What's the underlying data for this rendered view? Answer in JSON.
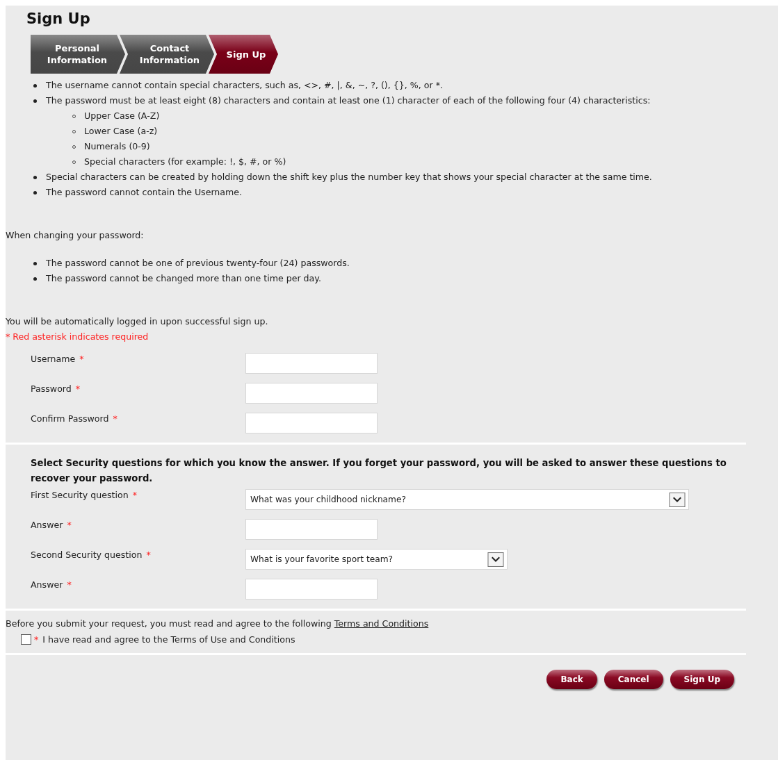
{
  "title": "Sign Up",
  "steps": [
    {
      "label": "Personal Information",
      "selected": false
    },
    {
      "label": "Contact Information",
      "selected": false
    },
    {
      "label": "Sign Up",
      "selected": true
    }
  ],
  "rules": [
    {
      "text": "The username cannot contain special characters, such as, <>, #, |, &, ~, ?, (), {}, %, or *."
    },
    {
      "text": "The password must be at least eight (8) characters and contain at least one (1) character of each of the following four (4) characteristics:",
      "children": [
        "Upper Case (A-Z)",
        "Lower Case (a-z)",
        "Numerals (0-9)",
        "Special characters (for example: !, $, #, or %)"
      ]
    },
    {
      "text": "Special characters can be created by holding down the shift key plus the number key that shows your special character at the same time."
    },
    {
      "text": "The password cannot contain the Username."
    }
  ],
  "password_change": {
    "heading": "When changing your password:",
    "rules": [
      "The password cannot be one of previous twenty-four (24) passwords.",
      "The password cannot be changed more than one time per day."
    ]
  },
  "auto_login_note": "You will be automatically logged in upon successful sign up.",
  "required_note": "* Red asterisk indicates required",
  "account_fields": [
    {
      "label": "Username",
      "asterisk": "*"
    },
    {
      "label": "Password",
      "asterisk": "*"
    },
    {
      "label": "Confirm Password",
      "asterisk": "*"
    }
  ],
  "security": {
    "instructions": "Select Security questions for which you know the answer. If you forget your password, you will be asked to answer these questions to recover your password.",
    "fields": [
      {
        "kind": "select",
        "label": "First Security question",
        "asterisk": "*",
        "value": "What was your childhood nickname?"
      },
      {
        "kind": "text",
        "label": "Answer",
        "asterisk": "*"
      },
      {
        "kind": "select",
        "label": "Second Security question",
        "asterisk": "*",
        "value": "What is your favorite sport team?"
      },
      {
        "kind": "text",
        "label": "Answer",
        "asterisk": "*"
      }
    ]
  },
  "terms": {
    "text": "Before you submit your request, you must read and agree to the following",
    "link": "Terms and Conditions",
    "agreement": {
      "asterisk": "*",
      "label": "I have read and agree to the Terms of Use and Conditions",
      "checked": false
    }
  },
  "buttons": [
    "Back",
    "Cancel",
    "Sign Up"
  ]
}
